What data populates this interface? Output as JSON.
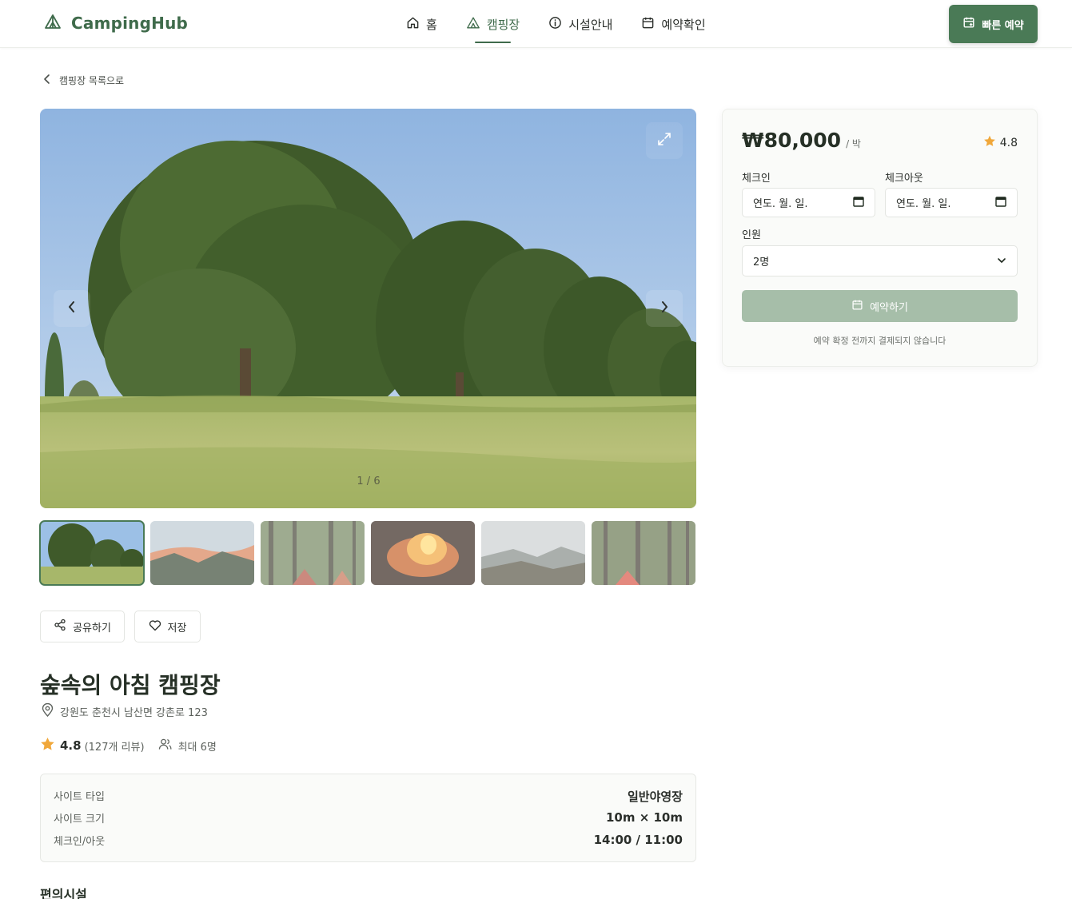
{
  "brand": {
    "name": "CampingHub",
    "accent": "#3f6b4b",
    "button": "#4a7a56"
  },
  "nav": {
    "items": [
      {
        "label": "홈",
        "icon": "home-icon"
      },
      {
        "label": "캠핑장",
        "icon": "tent-icon",
        "active": true
      },
      {
        "label": "시설안내",
        "icon": "info-icon"
      },
      {
        "label": "예약확인",
        "icon": "calendar-icon"
      }
    ],
    "quick_booking": "빠른 예약"
  },
  "back_link": "캠핑장 목록으로",
  "gallery": {
    "counter": "1 / 6",
    "thumbnail_count": 6,
    "active_index": 0
  },
  "actions": {
    "share": "공유하기",
    "save": "저장"
  },
  "campsite": {
    "name": "숲속의 아침 캠핑장",
    "address": "강원도 춘천시 남산면 강촌로 123",
    "rating": "4.8",
    "reviews": "(127개 리뷰)",
    "capacity": "최대 6명",
    "details": [
      {
        "key": "사이트 타입",
        "value": "일반야영장"
      },
      {
        "key": "사이트 크기",
        "value": "10m × 10m"
      },
      {
        "key": "체크인/아웃",
        "value": "14:00 / 11:00"
      }
    ],
    "amenities_title": "편의시설"
  },
  "booking": {
    "price": "₩80,000",
    "price_unit": "/ 박",
    "rating": "4.8",
    "checkin_label": "체크인",
    "checkout_label": "체크아웃",
    "date_placeholder": "연도. 월. 일.",
    "guests_label": "인원",
    "guests_value": "2명",
    "book_button": "예약하기",
    "note": "예약 확정 전까지 결제되지 않습니다"
  }
}
